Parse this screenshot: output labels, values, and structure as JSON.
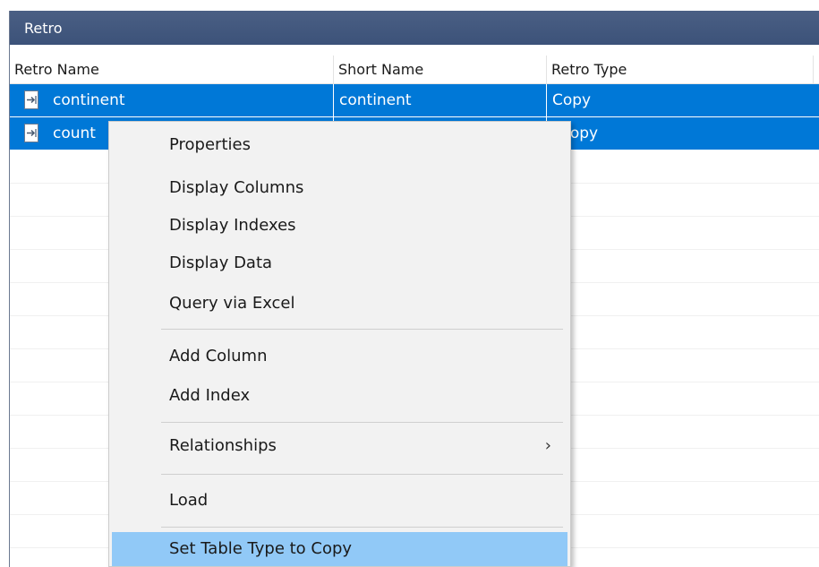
{
  "panel": {
    "title": "Retro"
  },
  "grid": {
    "columns": [
      {
        "label": "Retro Name"
      },
      {
        "label": "Short Name"
      },
      {
        "label": "Retro Type"
      }
    ],
    "rows": [
      {
        "name": "continent",
        "short_name": "continent",
        "type": "Copy",
        "selected": true,
        "icon": "table-file-icon"
      },
      {
        "name": "count",
        "short_name": "",
        "type": "Copy",
        "selected": true,
        "icon": "table-file-icon"
      }
    ]
  },
  "context_menu": {
    "items": [
      {
        "label": "Properties"
      },
      {
        "label": "Display Columns"
      },
      {
        "label": "Display Indexes"
      },
      {
        "label": "Display Data"
      },
      {
        "label": "Query via Excel"
      },
      {
        "label": "Add Column"
      },
      {
        "label": "Add Index"
      },
      {
        "label": "Relationships",
        "submenu_icon": "chevron-right-icon",
        "submenu_glyph": "›"
      },
      {
        "label": "Load"
      },
      {
        "label": "Set Table Type to Copy",
        "highlighted": true
      }
    ]
  },
  "colors": {
    "title_bar": "#3c5279",
    "selection": "#0078d7",
    "menu_highlight": "#91c9f7"
  }
}
